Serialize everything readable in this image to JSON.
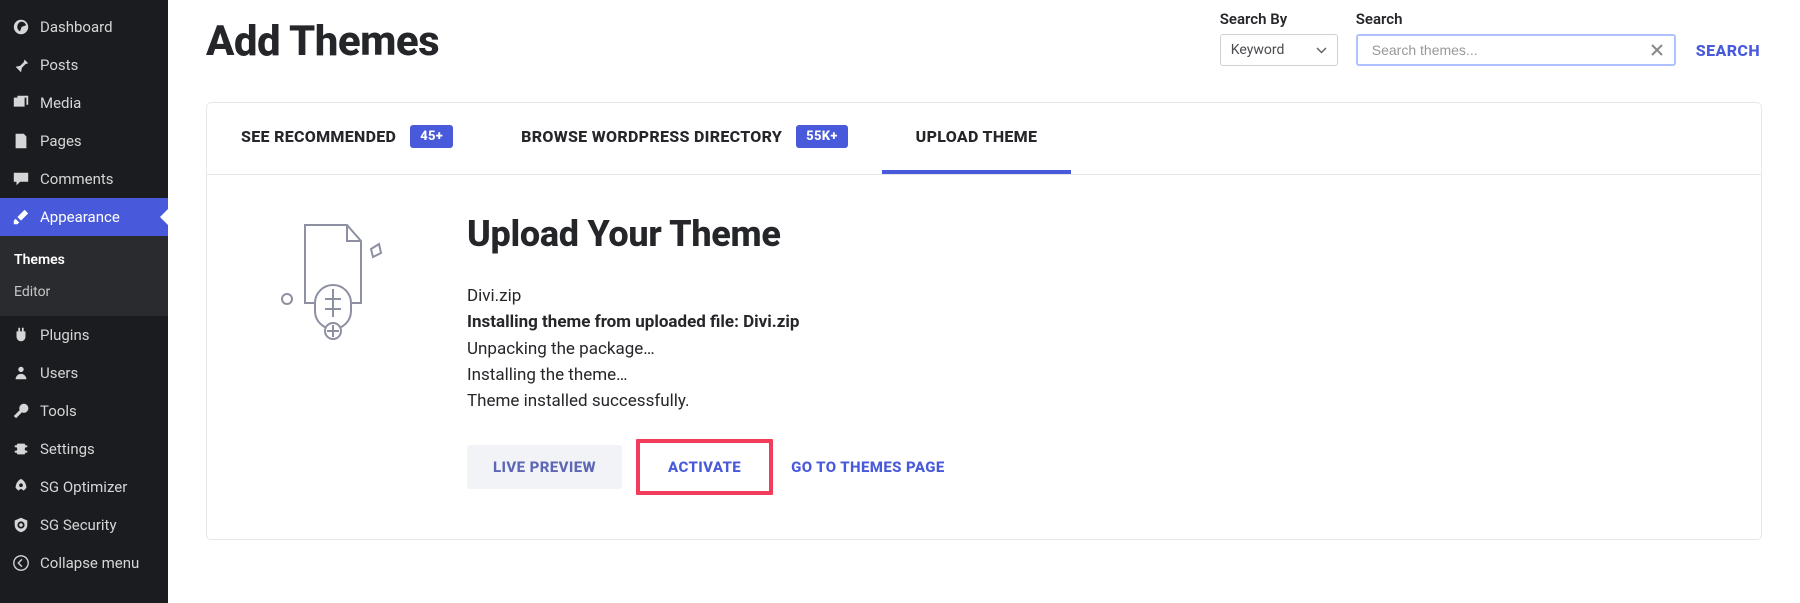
{
  "sidebar": {
    "items": [
      {
        "label": "Dashboard",
        "icon": "dashboard"
      },
      {
        "label": "Posts",
        "icon": "pin"
      },
      {
        "label": "Media",
        "icon": "media"
      },
      {
        "label": "Pages",
        "icon": "pages"
      },
      {
        "label": "Comments",
        "icon": "comments"
      },
      {
        "label": "Appearance",
        "icon": "brush"
      },
      {
        "label": "Plugins",
        "icon": "plug"
      },
      {
        "label": "Users",
        "icon": "users"
      },
      {
        "label": "Tools",
        "icon": "tools"
      },
      {
        "label": "Settings",
        "icon": "settings"
      },
      {
        "label": "SG Optimizer",
        "icon": "rocket"
      },
      {
        "label": "SG Security",
        "icon": "shield"
      },
      {
        "label": "Collapse menu",
        "icon": "collapse"
      }
    ],
    "sub": {
      "items": [
        {
          "label": "Themes"
        },
        {
          "label": "Editor"
        }
      ]
    }
  },
  "page": {
    "title": "Add Themes"
  },
  "search": {
    "by_label": "Search By",
    "search_label": "Search",
    "keyword": "Keyword",
    "placeholder": "Search themes...",
    "button": "SEARCH"
  },
  "tabs": [
    {
      "label": "SEE RECOMMENDED",
      "badge": "45+"
    },
    {
      "label": "BROWSE WORDPRESS DIRECTORY",
      "badge": "55K+"
    },
    {
      "label": "UPLOAD THEME",
      "badge": null
    }
  ],
  "upload": {
    "title": "Upload Your Theme",
    "file": "Divi.zip",
    "line2": "Installing theme from uploaded file: Divi.zip",
    "line3": "Unpacking the package…",
    "line4": "Installing the theme…",
    "line5": "Theme installed successfully.",
    "actions": {
      "live_preview": "LIVE PREVIEW",
      "activate": "ACTIVATE",
      "go_themes": "GO TO THEMES PAGE"
    }
  }
}
